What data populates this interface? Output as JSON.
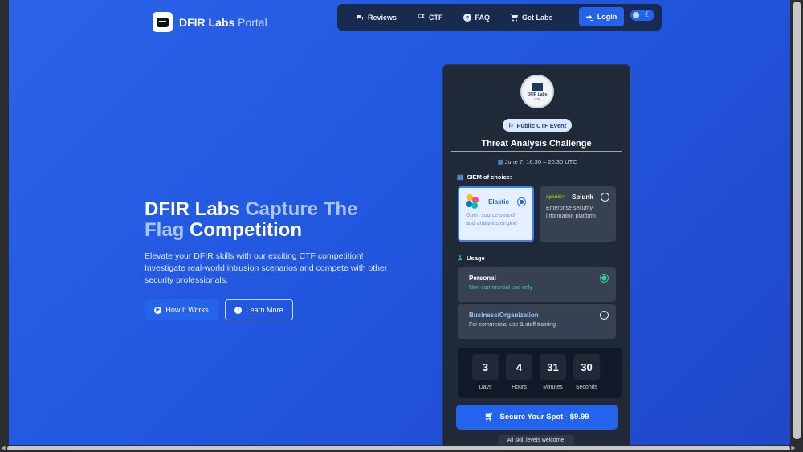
{
  "brand": {
    "name": "DFIR Labs",
    "suffix": "Portal"
  },
  "nav": {
    "items": [
      {
        "label": "Reviews",
        "icon": "comments-icon"
      },
      {
        "label": "CTF",
        "icon": "flag-icon"
      },
      {
        "label": "FAQ",
        "icon": "question-icon"
      },
      {
        "label": "Get Labs",
        "icon": "cart-icon"
      }
    ],
    "login_label": "Login"
  },
  "hero": {
    "title_part1": "DFIR Labs ",
    "title_accent": "Capture The Flag",
    "title_part2": " Competition",
    "description": "Elevate your DFIR skills with our exciting CTF competition! Investigate real-world intrusion scenarios and compete with other security professionals.",
    "how_label": "How It Works",
    "learn_label": "Learn More"
  },
  "card": {
    "logo_line1": "DFIR Labs",
    "logo_line2": "CTF",
    "badge": "Public CTF Event",
    "title": "Threat Analysis Challenge",
    "date": "June 7, 16:30 – 20:30 UTC",
    "siem_label": "SIEM of choice:",
    "siem_options": [
      {
        "name": "Elastic",
        "desc": "Open source search and analytics engine",
        "selected": true
      },
      {
        "name": "Splunk",
        "logo": "splunk>",
        "desc": "Enterprise security information platform",
        "selected": false
      }
    ],
    "usage_label": "Usage",
    "usage_options": [
      {
        "title": "Personal",
        "desc": "Non-commercial use only",
        "selected": true
      },
      {
        "title": "Business/Organization",
        "desc": "For commercial use & staff training",
        "selected": false
      }
    ],
    "countdown": [
      {
        "value": "3",
        "label": "Days"
      },
      {
        "value": "4",
        "label": "Hours"
      },
      {
        "value": "31",
        "label": "Minutes"
      },
      {
        "value": "30",
        "label": "Seconds"
      }
    ],
    "cta_label": "Secure Your Spot - $9.99",
    "footnote": "All skill levels welcome!"
  },
  "colors": {
    "primary": "#2463eb",
    "card_bg": "#1f2937",
    "accent_text": "#a9c6ff",
    "success": "#34d399"
  }
}
